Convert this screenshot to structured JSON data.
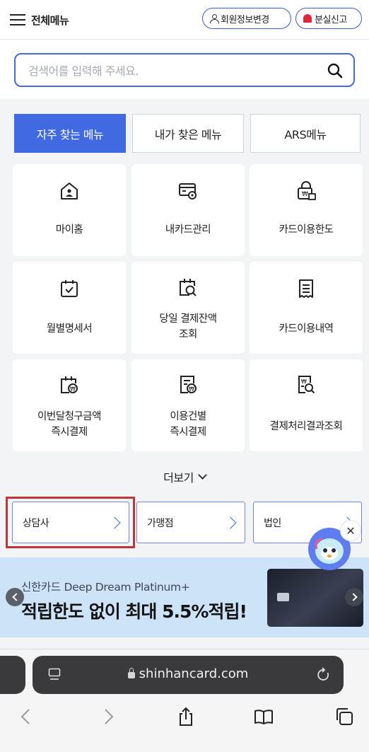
{
  "header": {
    "menu_label": "전체메뉴",
    "member_info_label": "회원정보변경",
    "lost_report_label": "분실신고"
  },
  "search": {
    "placeholder": "검색어를 입력해 주세요."
  },
  "tabs": [
    {
      "label": "자주 찾는 메뉴",
      "active": true
    },
    {
      "label": "내가 찾은 메뉴",
      "active": false
    },
    {
      "label": "ARS메뉴",
      "active": false
    }
  ],
  "tiles": [
    {
      "label": "마이홈",
      "icon": "home-person-icon"
    },
    {
      "label": "내카드관리",
      "icon": "card-settings-icon"
    },
    {
      "label": "카드이용한도",
      "icon": "limit-lock-icon"
    },
    {
      "label": "월별명세서",
      "icon": "calendar-check-icon"
    },
    {
      "label": "당일 결제잔액\n조회",
      "icon": "calendar-search-icon"
    },
    {
      "label": "카드이용내역",
      "icon": "receipt-icon"
    },
    {
      "label": "이번달청구금액\n즉시결제",
      "icon": "calendar-won-icon"
    },
    {
      "label": "이용건별\n즉시결제",
      "icon": "document-won-icon"
    },
    {
      "label": "결제처리결과조회",
      "icon": "document-search-icon"
    }
  ],
  "more_label": "더보기",
  "quick_links": [
    {
      "label": "상담사"
    },
    {
      "label": "가맹점"
    },
    {
      "label": "법인"
    }
  ],
  "banner": {
    "subtitle": "신한카드 Deep Dream Platinum+",
    "title": "적립한도 없이 최대 5.5%적립!"
  },
  "browser": {
    "url": "shinhancard.com"
  },
  "colors": {
    "accent": "#4169e1",
    "highlight_border": "#c0353a",
    "banner_bg": "#cde3f7"
  }
}
